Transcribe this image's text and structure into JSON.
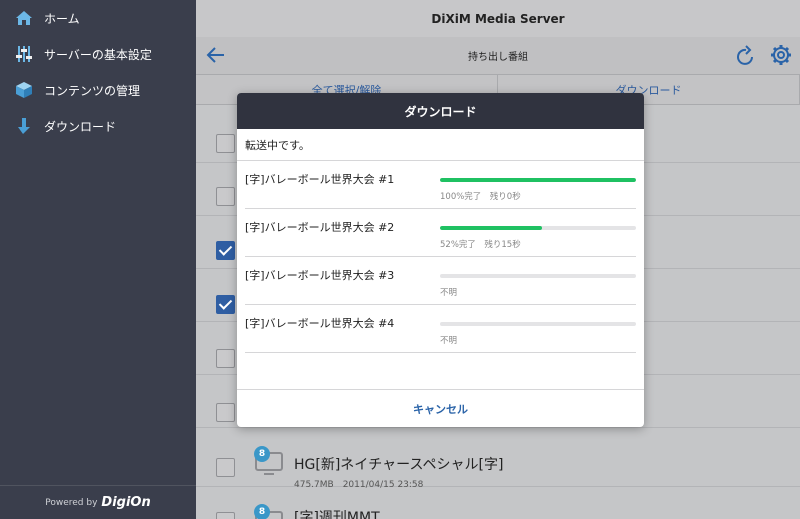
{
  "sidebar": {
    "items": [
      {
        "label": "ホーム",
        "icon": "home-icon"
      },
      {
        "label": "サーバーの基本設定",
        "icon": "sliders-icon"
      },
      {
        "label": "コンテンツの管理",
        "icon": "cube-icon"
      },
      {
        "label": "ダウンロード",
        "icon": "download-arrow-icon"
      }
    ],
    "footer_prefix": "Powered by",
    "footer_brand": "DigiOn"
  },
  "header": {
    "title": "DiXiM Media Server",
    "subtitle": "持ち出し番組"
  },
  "actions": {
    "select_all": "全て選択/解除",
    "download": "ダウンロード"
  },
  "background_list": [
    {
      "checked": false
    },
    {
      "checked": false
    },
    {
      "checked": true
    },
    {
      "checked": true
    },
    {
      "checked": false
    },
    {
      "checked": false
    },
    {
      "checked": false,
      "badge": "8",
      "title": "HG[新]ネイチャースペシャル[字]",
      "meta": "475.7MB　2011/04/15 23:58"
    },
    {
      "checked": false,
      "badge": "8",
      "title": "[字]週刊MMT",
      "meta": ""
    }
  ],
  "modal": {
    "title": "ダウンロード",
    "status": "転送中です。",
    "items": [
      {
        "name": "[字]バレーボール世界大会 #1",
        "progress": 1.0,
        "status": "100%完了　残り0秒"
      },
      {
        "name": "[字]バレーボール世界大会 #2",
        "progress": 0.52,
        "status": "52%完了　残り15秒"
      },
      {
        "name": "[字]バレーボール世界大会 #3",
        "progress": 0.0,
        "status": "不明"
      },
      {
        "name": "[字]バレーボール世界大会 #4",
        "progress": 0.0,
        "status": "不明"
      }
    ],
    "cancel": "キャンセル"
  },
  "colors": {
    "sidebar_bg": "#3a3e4c",
    "modal_header": "#30333f",
    "progress": "#1fc162",
    "accent": "#2a63a8"
  }
}
